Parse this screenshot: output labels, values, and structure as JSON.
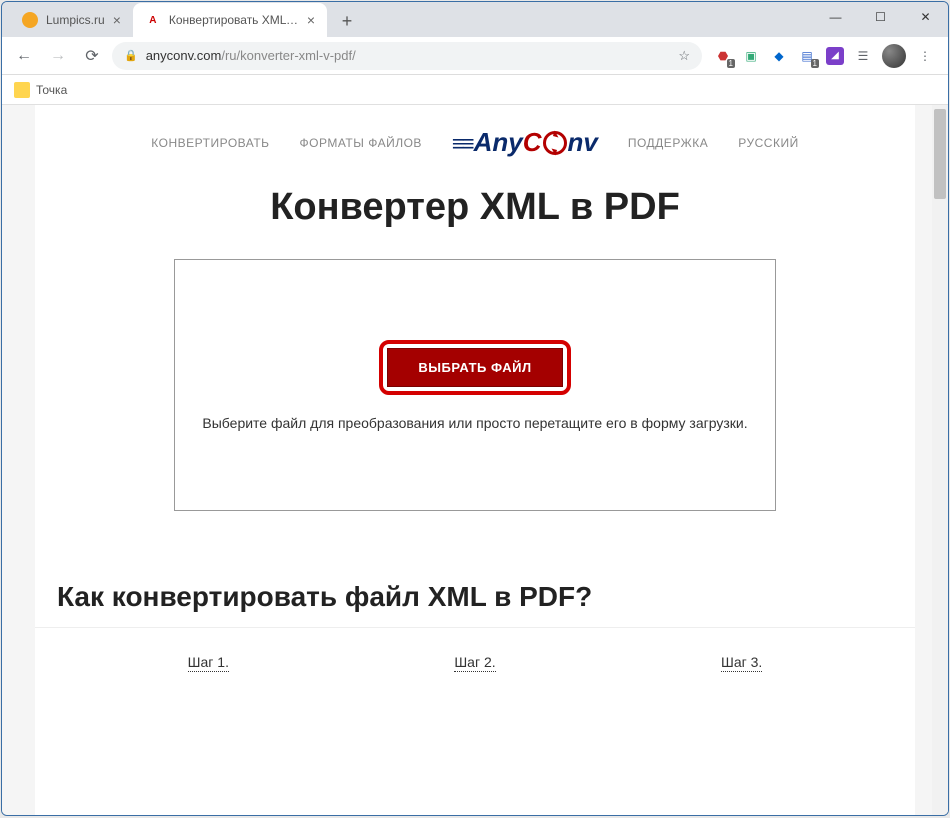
{
  "window": {
    "tabs": [
      {
        "title": "Lumpics.ru",
        "favicon_color": "#f5a623",
        "active": false
      },
      {
        "title": "Конвертировать XML в PDF онл",
        "favicon_letter": "A",
        "favicon_bg": "#c00",
        "active": true
      }
    ]
  },
  "toolbar": {
    "url_host": "anyconv.com",
    "url_path": "/ru/konverter-xml-v-pdf/",
    "star_icon": "star-icon"
  },
  "bookmarks": {
    "items": [
      "Точка"
    ]
  },
  "site": {
    "nav_left": [
      "КОНВЕРТИРОВАТЬ",
      "ФОРМАТЫ ФАЙЛОВ"
    ],
    "nav_right": [
      "ПОДДЕРЖКА",
      "РУССКИЙ"
    ],
    "logo": {
      "any": "Any",
      "c": "C",
      "nv": "nv"
    }
  },
  "main": {
    "h1": "Конвертер XML в PDF",
    "choose_label": "ВЫБРАТЬ ФАЙЛ",
    "hint": "Выберите файл для преобразования или просто перетащите его в форму загрузки."
  },
  "howto": {
    "h2": "Как конвертировать файл XML в PDF?",
    "steps": [
      "Шаг 1.",
      "Шаг 2.",
      "Шаг 3."
    ]
  }
}
